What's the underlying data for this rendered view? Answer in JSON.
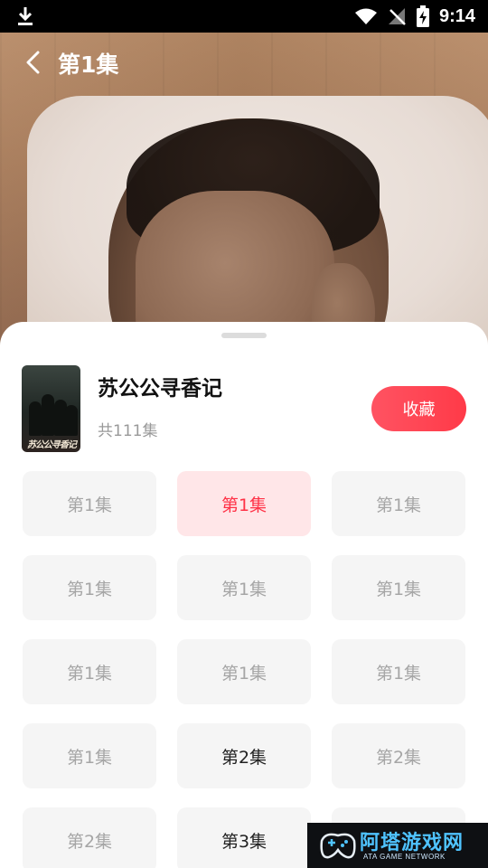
{
  "status_bar": {
    "time": "9:14",
    "icons": [
      "download-icon",
      "wifi-icon",
      "no-signal-icon",
      "battery-charging-icon"
    ]
  },
  "header": {
    "episode_title": "第1集",
    "back_icon": "chevron-left-icon"
  },
  "drama": {
    "title": "苏公公寻香记",
    "count": "共111集",
    "poster_logo": "苏公公寻香记",
    "collect_label": "收藏"
  },
  "episodes": [
    {
      "label": "第1集",
      "state": "locked"
    },
    {
      "label": "第1集",
      "state": "active"
    },
    {
      "label": "第1集",
      "state": "locked"
    },
    {
      "label": "第1集",
      "state": "locked"
    },
    {
      "label": "第1集",
      "state": "locked"
    },
    {
      "label": "第1集",
      "state": "locked"
    },
    {
      "label": "第1集",
      "state": "locked"
    },
    {
      "label": "第1集",
      "state": "locked"
    },
    {
      "label": "第1集",
      "state": "locked"
    },
    {
      "label": "第1集",
      "state": "locked"
    },
    {
      "label": "第2集",
      "state": "unlocked"
    },
    {
      "label": "第2集",
      "state": "locked"
    },
    {
      "label": "第2集",
      "state": "locked"
    },
    {
      "label": "第3集",
      "state": "unlocked"
    },
    {
      "label": "",
      "state": "locked"
    }
  ],
  "watermark": {
    "title": "阿塔游戏网",
    "subtitle": "ATA GAME NETWORK"
  },
  "colors": {
    "accent": "#ff3a48",
    "active_bg": "#ffe6e8",
    "active_text": "#ff3146",
    "cell_bg": "#f5f5f5",
    "muted_text": "#a6a6a6"
  }
}
